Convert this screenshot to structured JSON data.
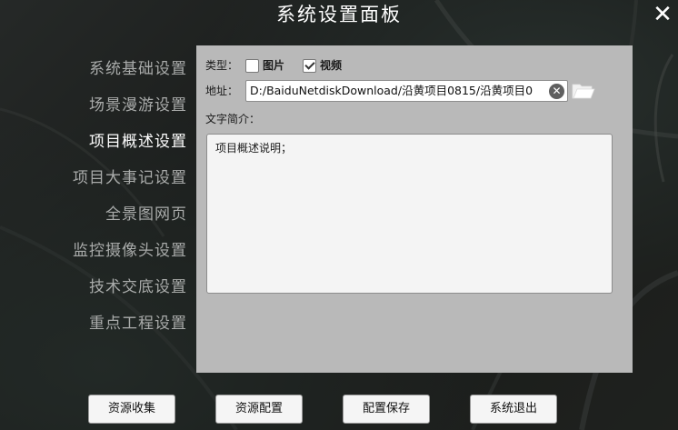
{
  "window": {
    "title": "系统设置面板",
    "close_symbol": "✕"
  },
  "nav": {
    "items": [
      {
        "label": "系统基础设置",
        "active": false
      },
      {
        "label": "场景漫游设置",
        "active": false
      },
      {
        "label": "项目概述设置",
        "active": true
      },
      {
        "label": "项目大事记设置",
        "active": false
      },
      {
        "label": "全景图网页",
        "active": false
      },
      {
        "label": "监控摄像头设置",
        "active": false
      },
      {
        "label": "技术交底设置",
        "active": false
      },
      {
        "label": "重点工程设置",
        "active": false
      }
    ]
  },
  "panel": {
    "type_label": "类型：",
    "type_options": [
      {
        "label": "图片",
        "checked": false
      },
      {
        "label": "视频",
        "checked": true
      }
    ],
    "address_label": "地址：",
    "address_value": "D:/BaiduNetdiskDownload/沿黄项目0815/沿黄项目0",
    "clear_symbol": "✕",
    "description_label": "文字简介：",
    "description_value": "项目概述说明；"
  },
  "buttons": {
    "collect": "资源收集",
    "configure": "资源配置",
    "save": "配置保存",
    "exit": "系统退出"
  },
  "icons": {
    "folder": "folder-open-icon",
    "clear": "clear-circle-icon",
    "close": "close-icon"
  },
  "colors": {
    "panel_bg": "#b9b9b9",
    "nav_active": "#ffffff",
    "nav_inactive": "#a9abaa"
  }
}
